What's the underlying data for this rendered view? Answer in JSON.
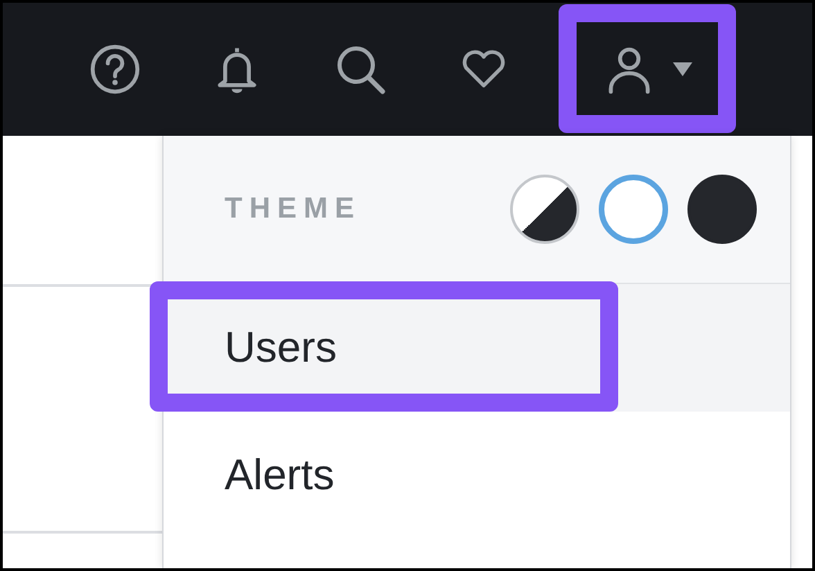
{
  "toolbar": {
    "buttons": [
      {
        "kind": "help"
      },
      {
        "kind": "bell"
      },
      {
        "kind": "search"
      },
      {
        "kind": "heart"
      }
    ],
    "user_menu": {
      "expanded": true,
      "highlighted": true
    }
  },
  "dropdown": {
    "theme_label": "THEME",
    "themes": [
      {
        "kind": "auto",
        "selected": false
      },
      {
        "kind": "light",
        "selected": true
      },
      {
        "kind": "dark",
        "selected": false
      }
    ],
    "items": [
      {
        "label": "Users",
        "selected": true,
        "highlighted": true
      },
      {
        "label": "Alerts",
        "selected": false,
        "highlighted": false
      }
    ]
  }
}
